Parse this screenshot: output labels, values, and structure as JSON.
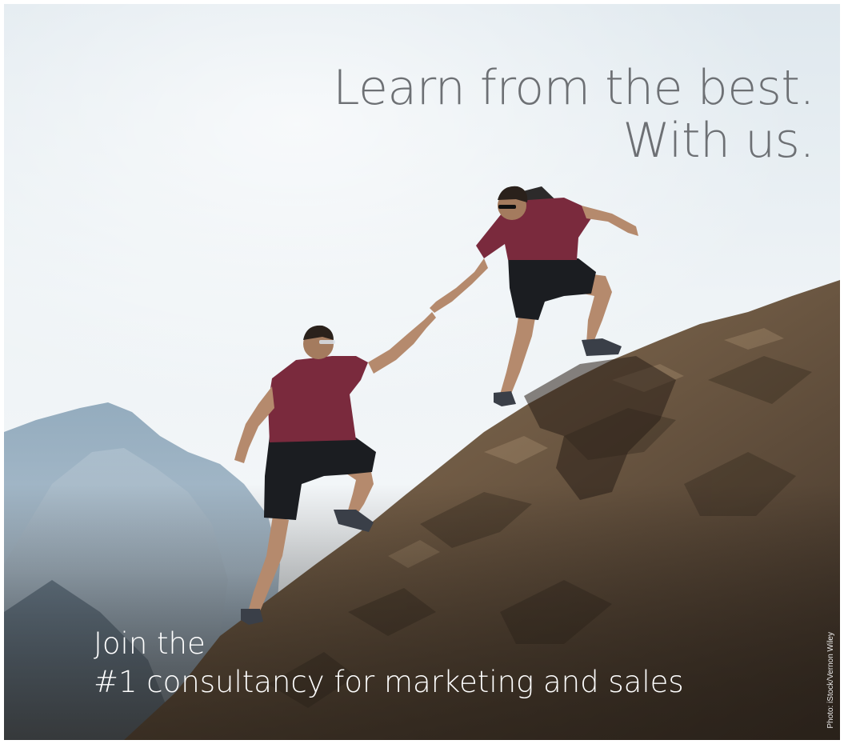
{
  "headline": {
    "line1": "Learn from the best.",
    "line2": "With us."
  },
  "subline": {
    "line1": "Join the",
    "line2": "#1 consultancy for marketing and sales"
  },
  "photo_credit": "Photo: iStock/Vernon Wiley",
  "photo": {
    "subject": "two-climbers-helping-hand-on-rock",
    "colors": {
      "sky": "#eaf0f4",
      "mountains": "#9bb1c2",
      "rock": "#6e5a46",
      "shirt": "#7a2a3d",
      "shorts": "#1b1d21",
      "headline_text": "#6d7074",
      "subline_text": "#ffffff"
    }
  }
}
